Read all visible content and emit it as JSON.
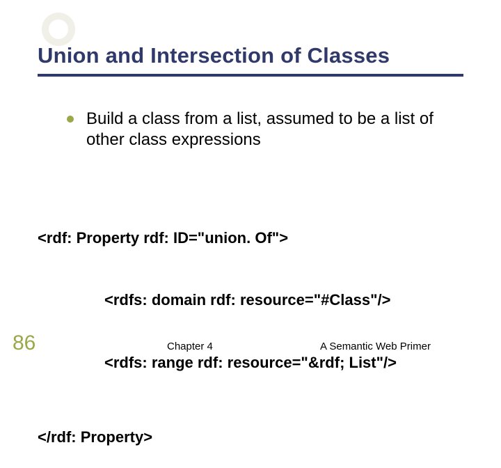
{
  "title": "Union and Intersection of Classes",
  "bullet": "Build a class from a list, assumed to be a list of other class expressions",
  "code": {
    "l1": "<rdf: Property rdf: ID=\"union. Of\">",
    "l2": "<rdfs: domain rdf: resource=\"#Class\"/>",
    "l3": "<rdfs: range rdf: resource=\"&rdf; List\"/>",
    "l4": "</rdf: Property>"
  },
  "slide_number": "86",
  "footer": {
    "chapter": "Chapter 4",
    "book": "A Semantic Web Primer"
  },
  "colors": {
    "title_navy": "#2f3a6b",
    "accent_olive": "#9aa84a"
  }
}
